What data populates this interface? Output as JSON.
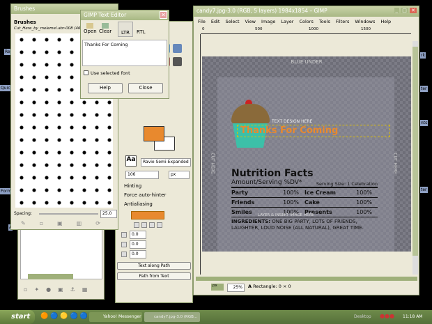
{
  "desktop": {
    "icons": [
      "Re",
      "Quic",
      "Form",
      "A",
      "rk",
      "ter",
      "nts",
      "ter"
    ]
  },
  "brushes": {
    "title": "Brushes",
    "heading": "Brushes",
    "brush_name": "Cut_Here_by_melemel.abr-008 (462 ×",
    "spacing_label": "Spacing:",
    "spacing_value": "25.0"
  },
  "text_editor": {
    "title": "GIMP Text Editor",
    "toolbar": {
      "open": "Open",
      "clear": "Clear",
      "ltr": "LTR",
      "rtl": "RTL"
    },
    "text": "Thanks For Coming",
    "use_font_label": "Use selected font",
    "help": "Help",
    "close": "Close"
  },
  "tool_options": {
    "font": "Ravie Semi-Expanded",
    "size": "106",
    "unit": "px",
    "hinting": "Hinting",
    "force_autohinter": "Force auto-hinter",
    "antialiasing": "Antialiasing",
    "color": "#e8892e",
    "indent": "0.0",
    "line_spacing": "0.0",
    "letter_spacing": "0.0",
    "text_along_path": "Text along Path",
    "path_from_text": "Path from Text",
    "fg_color": "#e8892e"
  },
  "image_window": {
    "title": "candy7.jpg-3.0 (RGB, 5 layers) 1984x1854 – GIMP",
    "menu": [
      "File",
      "Edit",
      "Select",
      "View",
      "Image",
      "Layer",
      "Colors",
      "Tools",
      "Filters",
      "Windows",
      "Help"
    ],
    "ruler": [
      "0",
      "500",
      "1000",
      "1500"
    ],
    "canvas": {
      "top_label": "BLUE UNDER",
      "side_label": "CUT HERE",
      "text_layer": "Thanks For Coming",
      "design_label": "TEXT DESIGN HERE",
      "mid_label": "LAYER & INSERT IMAGE HERE",
      "nutrition": {
        "title": "Nutrition Facts",
        "subtitle": "Amount/Serving %DV*",
        "serving": "Serving Size: 1 Celebration",
        "rows": [
          [
            "Party",
            "100%",
            "Ice Cream",
            "100%"
          ],
          [
            "Friends",
            "100%",
            "Cake",
            "100%"
          ],
          [
            "Smiles",
            "100%",
            "Presents",
            "100%"
          ]
        ],
        "ingredients_label": "INGREDIENTS:",
        "ingredients": "ONE BIG PARTY, LOTS OF FRIENDS, LAUGHTER, LOUD NOISE (ALL NATURAL), GREAT TIME."
      }
    },
    "status": {
      "unit": "px",
      "zoom": "25%",
      "info": "Rectangle: 0 × 0"
    }
  },
  "taskbar": {
    "start": "start",
    "items": [
      "Yahoo! Messenger",
      "candy7.jpg-3.0 (RGB..."
    ],
    "desktop": "Desktop",
    "clock": "11:18 AM"
  }
}
